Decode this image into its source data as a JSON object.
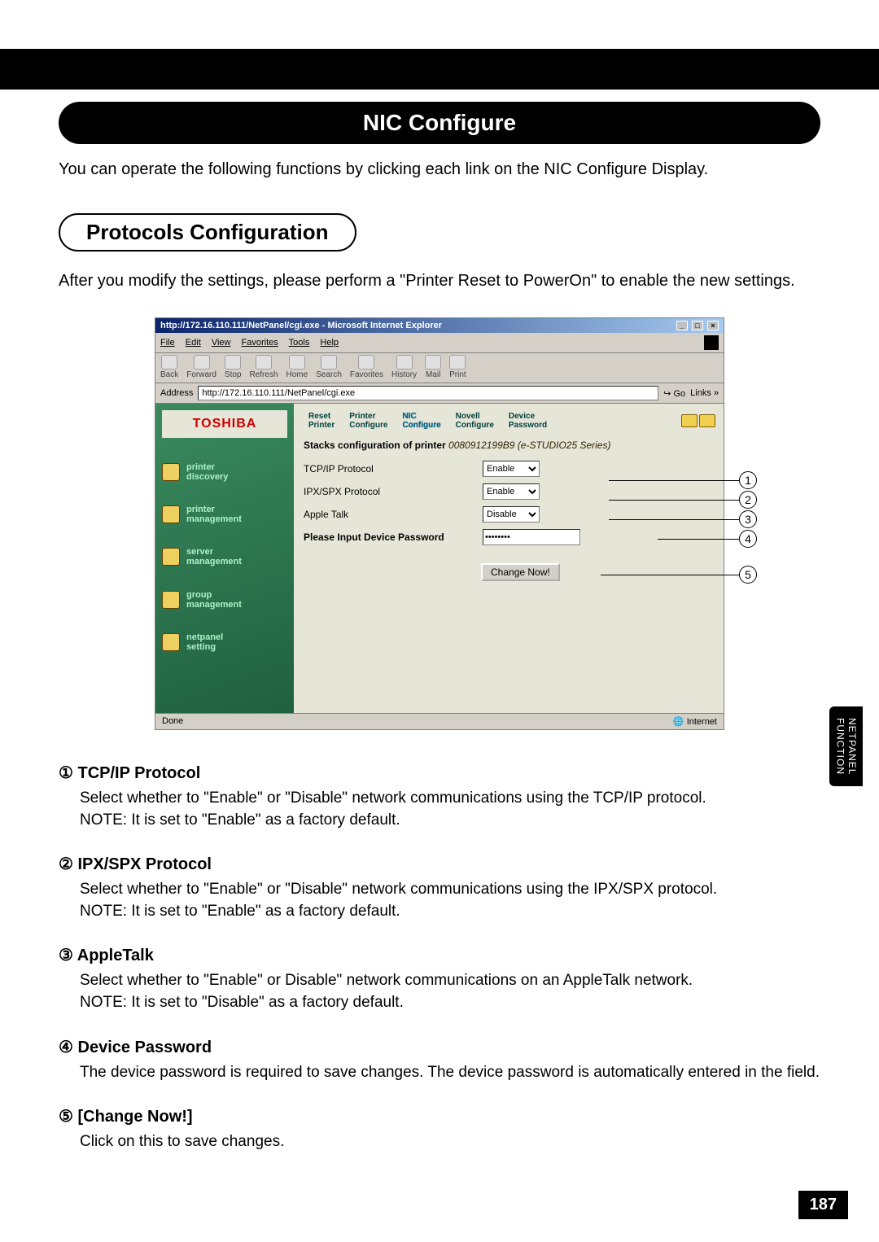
{
  "page": {
    "title_banner": "NIC Configure",
    "intro": "You can operate the following functions by clicking each link on the NIC Configure Display.",
    "section_heading": "Protocols Configuration",
    "section_text": "After you modify the settings, please perform a \"Printer Reset to PowerOn\" to enable the new settings.",
    "side_tab": "NETPANEL\nFUNCTION",
    "page_number": "187"
  },
  "ie": {
    "title": "http://172.16.110.111/NetPanel/cgi.exe - Microsoft Internet Explorer",
    "menus": [
      "File",
      "Edit",
      "View",
      "Favorites",
      "Tools",
      "Help"
    ],
    "toolbar": [
      "Back",
      "Forward",
      "Stop",
      "Refresh",
      "Home",
      "Search",
      "Favorites",
      "History",
      "Mail",
      "Print"
    ],
    "address_label": "Address",
    "address_value": "http://172.16.110.111/NetPanel/cgi.exe",
    "go_label": "Go",
    "links_label": "Links »",
    "status_left": "Done",
    "status_right": "Internet"
  },
  "panel": {
    "brand": "TOSHIBA",
    "side_items": [
      "printer\ndiscovery",
      "printer\nmanagement",
      "server\nmanagement",
      "group\nmanagement",
      "netpanel\nsetting"
    ],
    "tabs": [
      {
        "l1": "Reset",
        "l2": "Printer"
      },
      {
        "l1": "Printer",
        "l2": "Configure"
      },
      {
        "l1": "NIC",
        "l2": "Configure"
      },
      {
        "l1": "Novell",
        "l2": "Configure"
      },
      {
        "l1": "Device",
        "l2": "Password"
      }
    ],
    "active_tab_index": 2,
    "stacks_prefix": "Stacks configuration of printer",
    "stacks_id": "0080912199B9 (e-STUDIO25 Series)",
    "rows": [
      {
        "label": "TCP/IP Protocol",
        "value": "Enable"
      },
      {
        "label": "IPX/SPX Protocol",
        "value": "Enable"
      },
      {
        "label": "Apple Talk",
        "value": "Disable"
      }
    ],
    "password_label": "Please Input Device Password",
    "password_value": "********",
    "change_label": "Change Now!"
  },
  "callouts": [
    "1",
    "2",
    "3",
    "4",
    "5"
  ],
  "descriptions": [
    {
      "num": "①",
      "title": "TCP/IP Protocol",
      "body": "Select whether to \"Enable\" or \"Disable\" network communications using the TCP/IP protocol.\nNOTE: It is set to \"Enable\" as a factory default."
    },
    {
      "num": "②",
      "title": "IPX/SPX Protocol",
      "body": "Select whether to \"Enable\" or \"Disable\" network communications using the IPX/SPX protocol.\nNOTE: It is set to \"Enable\" as a factory default."
    },
    {
      "num": "③",
      "title": "AppleTalk",
      "body": "Select whether to \"Enable\" or Disable\" network communications on an AppleTalk network.\nNOTE: It is set to \"Disable\" as a factory default."
    },
    {
      "num": "④",
      "title": "Device Password",
      "body": "The device password is required to save changes.  The device password is automatically entered in the field."
    },
    {
      "num": "⑤",
      "title": "[Change Now!]",
      "body": "Click on this to save changes."
    }
  ]
}
